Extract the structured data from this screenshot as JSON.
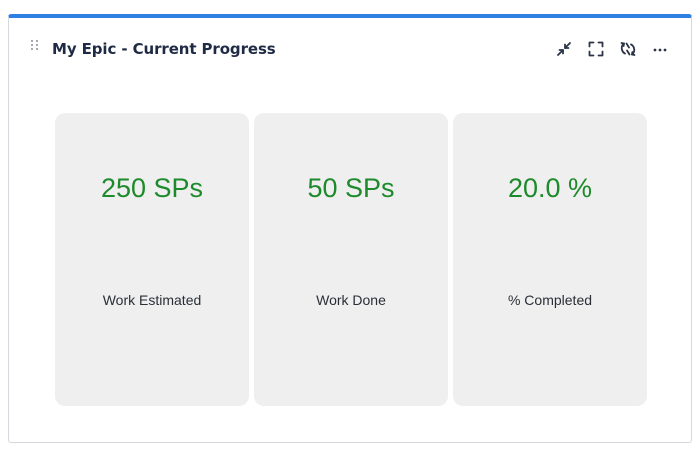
{
  "gadget": {
    "title": "My Epic - Current Progress",
    "accent_color": "#2f80e4",
    "toolbar": {
      "icons": [
        "minimize-icon",
        "fullscreen-icon",
        "refresh-icon",
        "more-icon"
      ],
      "more_label": "···"
    }
  },
  "metrics": [
    {
      "value": "250 SPs",
      "label": "Work Estimated"
    },
    {
      "value": "50 SPs",
      "label": "Work Done"
    },
    {
      "value": "20.0 %",
      "label": "% Completed"
    }
  ],
  "colors": {
    "value_text": "#1d8a2b",
    "card_background": "#efefef",
    "title_text": "#1f2a44"
  }
}
